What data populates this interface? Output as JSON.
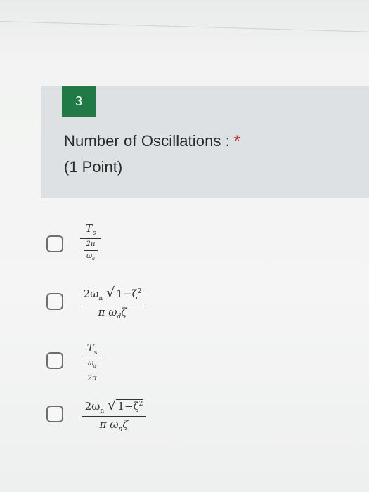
{
  "question": {
    "number": "3",
    "title": "Number of Oscillations :",
    "required_marker": "*",
    "points": "(1 Point)"
  },
  "options": [
    {
      "kind": "nested-fraction",
      "top": "T",
      "top_sub": "s",
      "bottom_num": "2π",
      "bottom_den": "ω",
      "bottom_den_sub": "d"
    },
    {
      "kind": "sqrt-fraction",
      "num_coef": "2ω",
      "num_coef_sub": "n",
      "radicand": "1−ζ",
      "radicand_sup": "2",
      "den_a": "π",
      "den_b": "ω",
      "den_b_sub": "d",
      "den_c": "ζ"
    },
    {
      "kind": "nested-fraction",
      "top": "T",
      "top_sub": "s",
      "bottom_num": "ω",
      "bottom_num_sub": "d",
      "bottom_den": "2π"
    },
    {
      "kind": "sqrt-fraction",
      "num_coef": "2ω",
      "num_coef_sub": "n",
      "radicand": "1−ζ",
      "radicand_sup": "2",
      "den_a": "π",
      "den_b": "ω",
      "den_b_sub": "n",
      "den_c": "ζ"
    }
  ]
}
